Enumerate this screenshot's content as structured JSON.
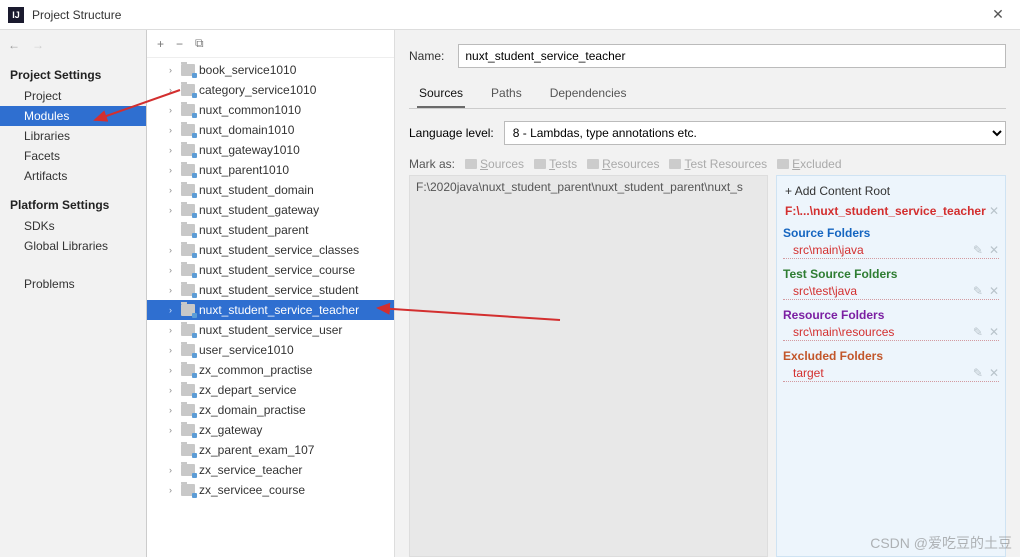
{
  "title": "Project Structure",
  "sidebar": {
    "group1": "Project Settings",
    "items1": [
      "Project",
      "Modules",
      "Libraries",
      "Facets",
      "Artifacts"
    ],
    "selected1": 1,
    "group2": "Platform Settings",
    "items2": [
      "SDKs",
      "Global Libraries"
    ],
    "extra": "Problems"
  },
  "tree": [
    {
      "label": "book_service1010",
      "expandable": true
    },
    {
      "label": "category_service1010",
      "expandable": true
    },
    {
      "label": "nuxt_common1010",
      "expandable": true
    },
    {
      "label": "nuxt_domain1010",
      "expandable": true
    },
    {
      "label": "nuxt_gateway1010",
      "expandable": true
    },
    {
      "label": "nuxt_parent1010",
      "expandable": true
    },
    {
      "label": "nuxt_student_domain",
      "expandable": true
    },
    {
      "label": "nuxt_student_gateway",
      "expandable": true
    },
    {
      "label": "nuxt_student_parent",
      "expandable": false
    },
    {
      "label": "nuxt_student_service_classes",
      "expandable": true
    },
    {
      "label": "nuxt_student_service_course",
      "expandable": true
    },
    {
      "label": "nuxt_student_service_student",
      "expandable": true
    },
    {
      "label": "nuxt_student_service_teacher",
      "expandable": true,
      "selected": true
    },
    {
      "label": "nuxt_student_service_user",
      "expandable": true
    },
    {
      "label": "user_service1010",
      "expandable": true
    },
    {
      "label": "zx_common_practise",
      "expandable": true
    },
    {
      "label": "zx_depart_service",
      "expandable": true
    },
    {
      "label": "zx_domain_practise",
      "expandable": true
    },
    {
      "label": "zx_gateway",
      "expandable": true
    },
    {
      "label": "zx_parent_exam_107",
      "expandable": false
    },
    {
      "label": "zx_service_teacher",
      "expandable": true
    },
    {
      "label": "zx_servicee_course",
      "expandable": true
    }
  ],
  "content": {
    "name_label": "Name:",
    "name_value": "nuxt_student_service_teacher",
    "tabs": [
      "Sources",
      "Paths",
      "Dependencies"
    ],
    "active_tab": 0,
    "lang_label": "Language level:",
    "lang_value": "8 - Lambdas, type annotations etc.",
    "mark_label": "Mark as:",
    "mark_buttons": [
      "Sources",
      "Tests",
      "Resources",
      "Test Resources",
      "Excluded"
    ],
    "path": "F:\\2020java\\nuxt_student_parent\\nuxt_student_parent\\nuxt_s",
    "add_root": "Add Content Root",
    "root_path": "F:\\...\\nuxt_student_service_teacher",
    "groups": [
      {
        "title": "Source Folders",
        "cls": "src",
        "items": [
          "src\\main\\java"
        ]
      },
      {
        "title": "Test Source Folders",
        "cls": "test",
        "items": [
          "src\\test\\java"
        ]
      },
      {
        "title": "Resource Folders",
        "cls": "res",
        "items": [
          "src\\main\\resources"
        ]
      },
      {
        "title": "Excluded Folders",
        "cls": "exc",
        "items": [
          "target"
        ]
      }
    ]
  },
  "watermark": "CSDN @爱吃豆的土豆"
}
